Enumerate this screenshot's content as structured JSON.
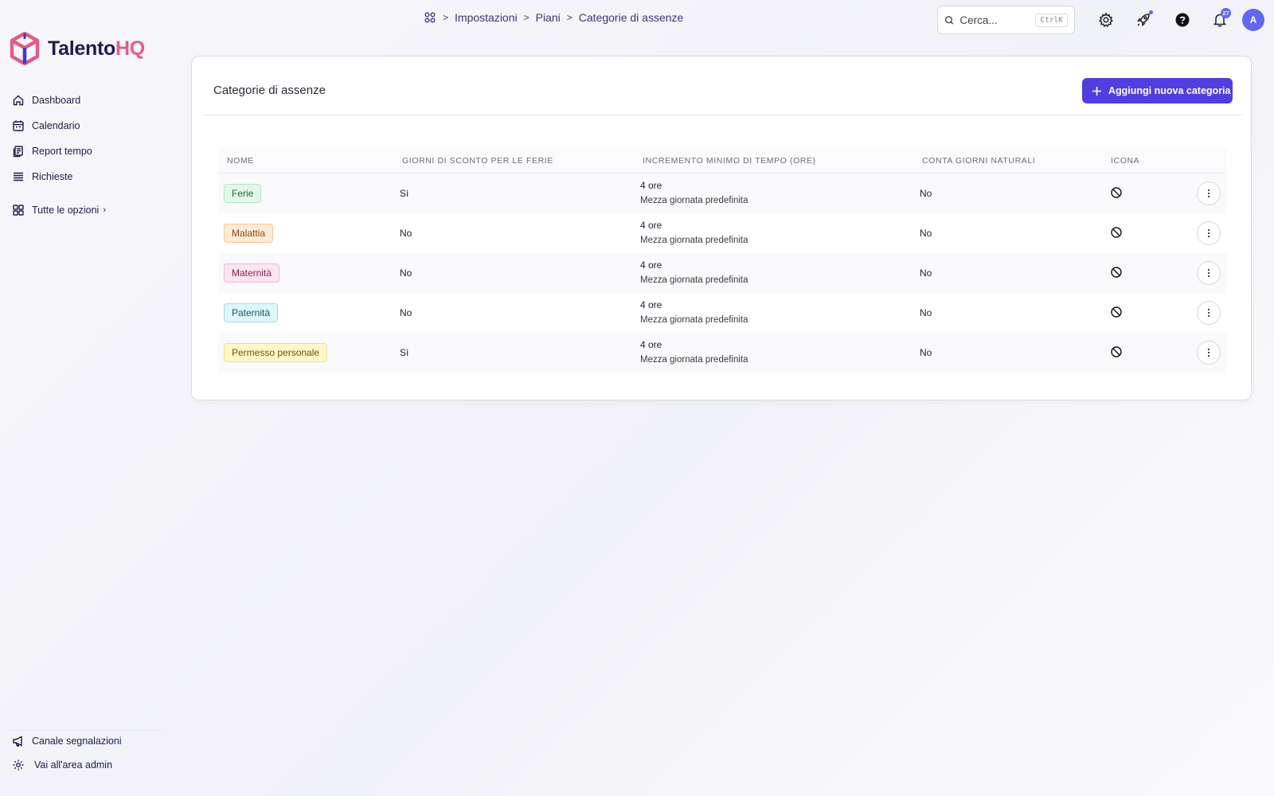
{
  "app": {
    "brand_main": "Talento",
    "brand_accent": "HQ",
    "accent_color": "#4f3ee0",
    "brand_pink": "#e05e86"
  },
  "breadcrumb": {
    "items": [
      "Impostazioni",
      "Piani",
      "Categorie di assenze"
    ]
  },
  "search": {
    "placeholder": "Cerca...",
    "shortcut": "CtrlK"
  },
  "notifications": {
    "count": "27"
  },
  "user": {
    "initial": "A"
  },
  "sidebar": {
    "items": [
      {
        "label": "Dashboard",
        "icon": "home-icon"
      },
      {
        "label": "Calendario",
        "icon": "calendar-icon"
      },
      {
        "label": "Report tempo",
        "icon": "report-icon"
      },
      {
        "label": "Richieste",
        "icon": "list-icon"
      }
    ],
    "more": {
      "label": "Tutte le opzioni",
      "icon": "grid-icon"
    },
    "bottom": [
      {
        "label": "Canale segnalazioni",
        "icon": "megaphone-icon"
      },
      {
        "label": "Vai all'area admin",
        "icon": "gear-icon"
      }
    ]
  },
  "page": {
    "title": "Categorie di assenze",
    "add_button": "Aggiungi nuova categoria"
  },
  "table": {
    "headers": [
      "NOME",
      "GIORNI DI SCONTO PER LE FERIE",
      "INCREMENTO MINIMO DI TEMPO (ORE)",
      "CONTA GIORNI NATURALI",
      "ICONA"
    ],
    "rows": [
      {
        "name": "Ferie",
        "color": "green",
        "discount": "Sì",
        "increment": "4 ore",
        "increment_note": "Mezza giornata predefinita",
        "natural": "No",
        "icon": "no-icon"
      },
      {
        "name": "Malattia",
        "color": "orange",
        "discount": "No",
        "increment": "4 ore",
        "increment_note": "Mezza giornata predefinita",
        "natural": "No",
        "icon": "no-icon"
      },
      {
        "name": "Maternità",
        "color": "pink",
        "discount": "No",
        "increment": "4 ore",
        "increment_note": "Mezza giornata predefinita",
        "natural": "No",
        "icon": "no-icon"
      },
      {
        "name": "Paternità",
        "color": "cyan",
        "discount": "No",
        "increment": "4 ore",
        "increment_note": "Mezza giornata predefinita",
        "natural": "No",
        "icon": "no-icon"
      },
      {
        "name": "Permesso personale",
        "color": "yellow",
        "discount": "Sì",
        "increment": "4 ore",
        "increment_note": "Mezza giornata predefinita",
        "natural": "No",
        "icon": "no-icon"
      }
    ]
  }
}
